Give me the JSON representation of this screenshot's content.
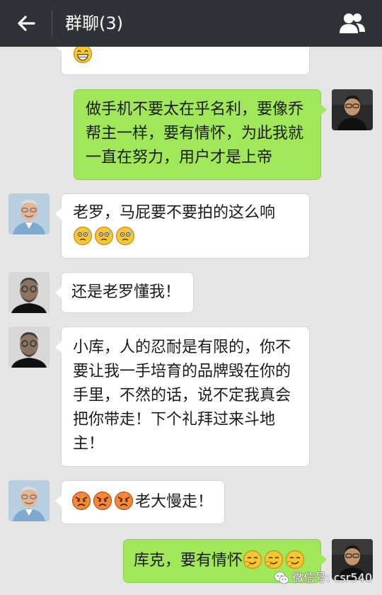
{
  "header": {
    "title": "群聊(3)"
  },
  "messages": [
    {
      "side": "left",
      "sender": "tim",
      "text": "",
      "emoji": [
        "grin-face"
      ]
    },
    {
      "side": "right",
      "sender": "luo",
      "text": "做手机不要太在乎名利，要像乔帮主一样，要有情怀，为此我就一直在努力，用户才是上帝",
      "emoji": []
    },
    {
      "side": "left",
      "sender": "tim",
      "text": "老罗，马屁要不要拍的这么响",
      "emoji": [
        "sweat-face",
        "sweat-face",
        "sweat-face"
      ]
    },
    {
      "side": "left",
      "sender": "steve",
      "text": "还是老罗懂我！",
      "emoji": []
    },
    {
      "side": "left",
      "sender": "steve",
      "text": "小库，人的忍耐是有限的，你不要让我一手培育的品牌毁在你的手里，不然的话，说不定我真会把你带走！下个礼拜过来斗地主！",
      "emoji": []
    },
    {
      "side": "left",
      "sender": "tim",
      "text": "老大慢走！",
      "emoji": [
        "angry-face",
        "angry-face",
        "angry-face"
      ]
    },
    {
      "side": "right",
      "sender": "luo",
      "text": "库克，要有情怀",
      "emoji": [
        "sly-face",
        "sly-face",
        "sly-face"
      ]
    }
  ],
  "watermark": {
    "text": "微信号: csr540"
  },
  "colors": {
    "topbar": "#2f3236",
    "background": "#e5e5e5",
    "my_bubble": "#a0e75a",
    "other_bubble": "#ffffff"
  }
}
